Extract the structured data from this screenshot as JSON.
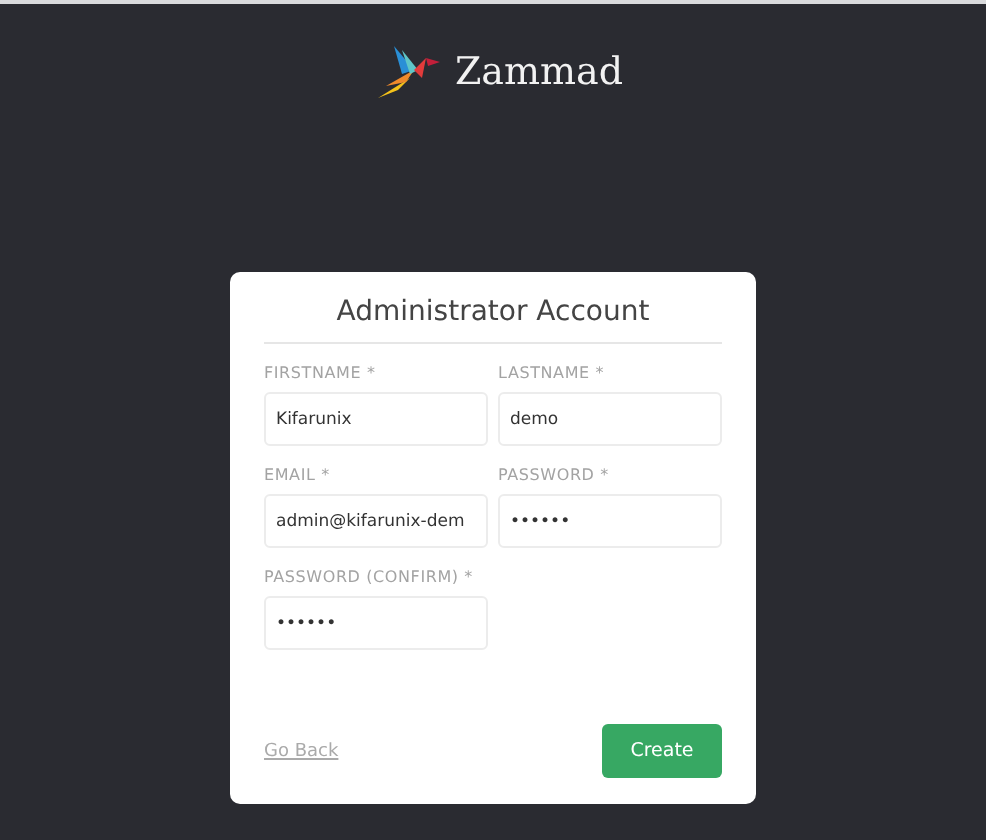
{
  "logo": {
    "text": "Zammad"
  },
  "card": {
    "title": "Administrator Account",
    "fields": [
      {
        "label": "FIRSTNAME *",
        "value": "Kifarunix"
      },
      {
        "label": "LASTNAME *",
        "value": "demo"
      },
      {
        "label": "EMAIL *",
        "value": "admin@kifarunix-dem"
      },
      {
        "label": "PASSWORD *",
        "value": "••••••"
      },
      {
        "label": "PASSWORD (CONFIRM) *",
        "value": "••••••"
      }
    ],
    "back_link": "Go Back",
    "submit": "Create"
  }
}
